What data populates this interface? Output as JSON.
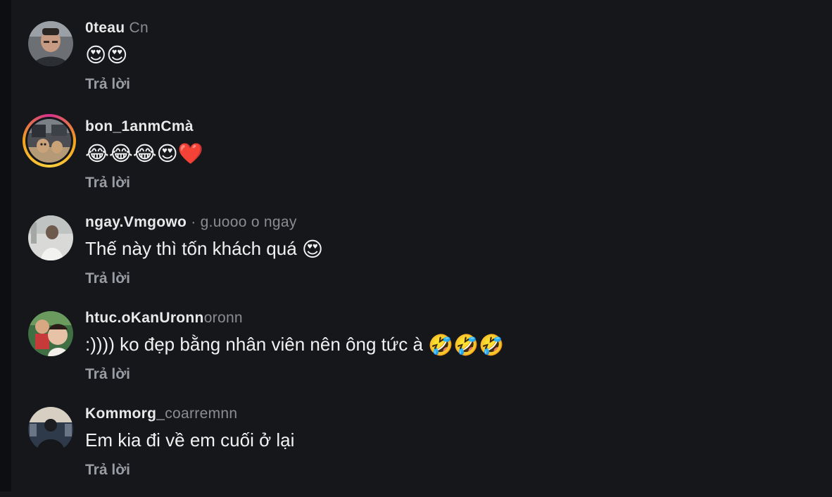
{
  "reply_label": "Trả lời",
  "comments": [
    {
      "username": "0teau",
      "username_fade": " Cn",
      "text": "",
      "emojis": [
        "😍",
        "😍"
      ]
    },
    {
      "username": "bon_1anmCmà",
      "username_fade": "",
      "text": "",
      "emojis": [
        "😂",
        "😂",
        "😂",
        "😍",
        "❤️"
      ]
    },
    {
      "username": "ngay.Vmgowo",
      "username_fade": " ·  g.uooo o ngay",
      "text": "Thế này thì tốn khách quá",
      "emojis": [
        "😍"
      ]
    },
    {
      "username": "htuc.oKanUronn",
      "username_fade": "oronn",
      "text": ":)))) ko đẹp bằng nhân viên nên ông tức à",
      "emojis": [
        "🤣",
        "🤣",
        "🤣"
      ]
    },
    {
      "username": "Kommorg_",
      "username_fade": "coarremnn",
      "text": "Em kia đi về em cuối ở lại",
      "emojis": []
    }
  ],
  "colors": {
    "background": "#15171b",
    "text": "#f1f1f1",
    "muted": "#9a9ca3",
    "story_ring_a": "#d52f8d",
    "story_ring_b": "#f2a21c"
  }
}
